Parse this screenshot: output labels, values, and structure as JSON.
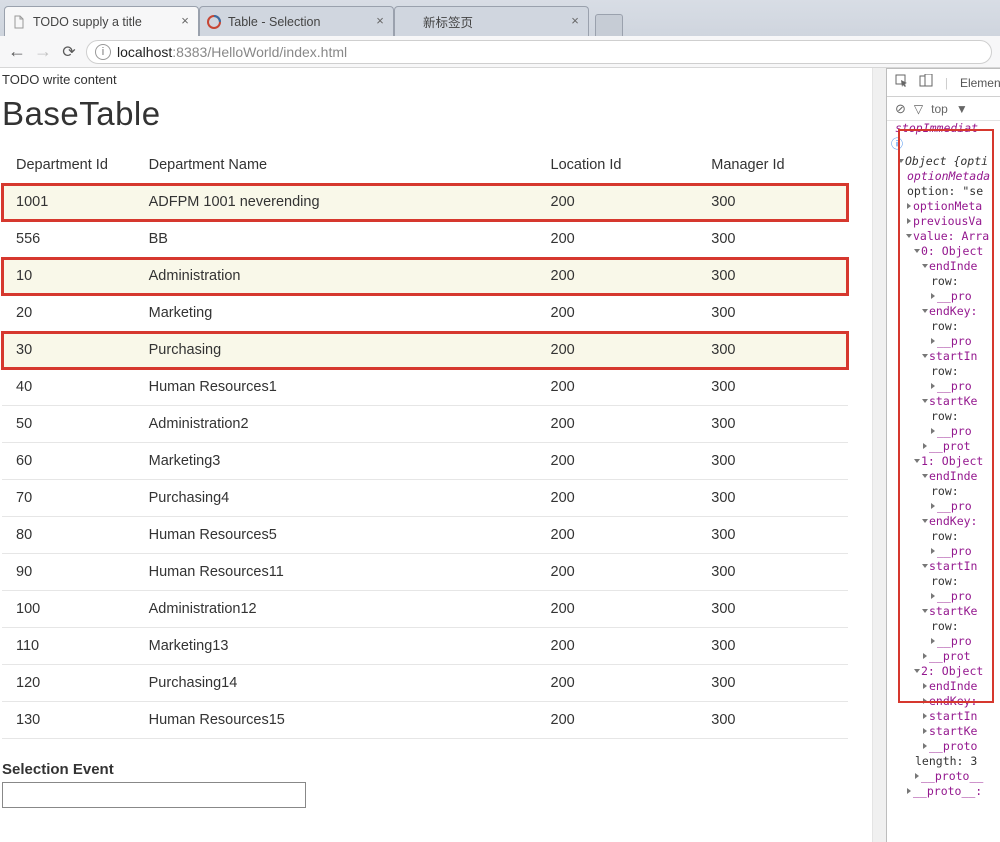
{
  "chrome": {
    "tabs": [
      {
        "title": "TODO supply a title",
        "favicon": "file"
      },
      {
        "title": "Table - Selection",
        "favicon": "oracle"
      },
      {
        "title": "新标签页",
        "favicon": ""
      }
    ],
    "url_host": "localhost",
    "url_port": ":8383",
    "url_path": "/HelloWorld/index.html"
  },
  "page": {
    "todo": "TODO write content",
    "heading": "BaseTable",
    "columns": [
      "Department Id",
      "Department Name",
      "Location Id",
      "Manager Id"
    ],
    "rows": [
      {
        "selected": true,
        "id": "1001",
        "name": "ADFPM 1001 neverending",
        "loc": "200",
        "mgr": "300"
      },
      {
        "selected": false,
        "id": "556",
        "name": "BB",
        "loc": "200",
        "mgr": "300"
      },
      {
        "selected": true,
        "id": "10",
        "name": "Administration",
        "loc": "200",
        "mgr": "300"
      },
      {
        "selected": false,
        "id": "20",
        "name": "Marketing",
        "loc": "200",
        "mgr": "300"
      },
      {
        "selected": true,
        "id": "30",
        "name": "Purchasing",
        "loc": "200",
        "mgr": "300"
      },
      {
        "selected": false,
        "id": "40",
        "name": "Human Resources1",
        "loc": "200",
        "mgr": "300"
      },
      {
        "selected": false,
        "id": "50",
        "name": "Administration2",
        "loc": "200",
        "mgr": "300"
      },
      {
        "selected": false,
        "id": "60",
        "name": "Marketing3",
        "loc": "200",
        "mgr": "300"
      },
      {
        "selected": false,
        "id": "70",
        "name": "Purchasing4",
        "loc": "200",
        "mgr": "300"
      },
      {
        "selected": false,
        "id": "80",
        "name": "Human Resources5",
        "loc": "200",
        "mgr": "300"
      },
      {
        "selected": false,
        "id": "90",
        "name": "Human Resources11",
        "loc": "200",
        "mgr": "300"
      },
      {
        "selected": false,
        "id": "100",
        "name": "Administration12",
        "loc": "200",
        "mgr": "300"
      },
      {
        "selected": false,
        "id": "110",
        "name": "Marketing13",
        "loc": "200",
        "mgr": "300"
      },
      {
        "selected": false,
        "id": "120",
        "name": "Purchasing14",
        "loc": "200",
        "mgr": "300"
      },
      {
        "selected": false,
        "id": "130",
        "name": "Human Resources15",
        "loc": "200",
        "mgr": "300"
      }
    ],
    "selection_label": "Selection Event"
  },
  "devtools": {
    "tab_label": "Elemen",
    "filter_label": "top",
    "stop_line": "stopImmediat",
    "lines": [
      {
        "pad": 1,
        "arrow": "open",
        "text": "Object {opti",
        "cls": "k-italic"
      },
      {
        "pad": 2,
        "arrow": "none",
        "text": "optionMetada",
        "cls": "k-purple k-italic"
      },
      {
        "pad": 2,
        "arrow": "none",
        "text": "option: \"se",
        "cls": ""
      },
      {
        "pad": 2,
        "arrow": "closed",
        "text": "optionMeta",
        "cls": "k-purple"
      },
      {
        "pad": 2,
        "arrow": "closed",
        "text": "previousVa",
        "cls": "k-purple"
      },
      {
        "pad": 2,
        "arrow": "open",
        "text": "value: Arra",
        "cls": "k-purple"
      },
      {
        "pad": 3,
        "arrow": "open",
        "text": "0: Object",
        "cls": "k-purple"
      },
      {
        "pad": 4,
        "arrow": "open",
        "text": "endInde",
        "cls": "k-purple"
      },
      {
        "pad": 5,
        "arrow": "none",
        "text": "row:",
        "cls": ""
      },
      {
        "pad": 5,
        "arrow": "closed",
        "text": "__pro",
        "cls": "k-purple"
      },
      {
        "pad": 4,
        "arrow": "open",
        "text": "endKey:",
        "cls": "k-purple"
      },
      {
        "pad": 5,
        "arrow": "none",
        "text": "row:",
        "cls": ""
      },
      {
        "pad": 5,
        "arrow": "closed",
        "text": "__pro",
        "cls": "k-purple"
      },
      {
        "pad": 4,
        "arrow": "open",
        "text": "startIn",
        "cls": "k-purple"
      },
      {
        "pad": 5,
        "arrow": "none",
        "text": "row:",
        "cls": ""
      },
      {
        "pad": 5,
        "arrow": "closed",
        "text": "__pro",
        "cls": "k-purple"
      },
      {
        "pad": 4,
        "arrow": "open",
        "text": "startKe",
        "cls": "k-purple"
      },
      {
        "pad": 5,
        "arrow": "none",
        "text": "row:",
        "cls": ""
      },
      {
        "pad": 5,
        "arrow": "closed",
        "text": "__pro",
        "cls": "k-purple"
      },
      {
        "pad": 4,
        "arrow": "closed",
        "text": "__prot",
        "cls": "k-purple"
      },
      {
        "pad": 3,
        "arrow": "open",
        "text": "1: Object",
        "cls": "k-purple"
      },
      {
        "pad": 4,
        "arrow": "open",
        "text": "endInde",
        "cls": "k-purple"
      },
      {
        "pad": 5,
        "arrow": "none",
        "text": "row:",
        "cls": ""
      },
      {
        "pad": 5,
        "arrow": "closed",
        "text": "__pro",
        "cls": "k-purple"
      },
      {
        "pad": 4,
        "arrow": "open",
        "text": "endKey:",
        "cls": "k-purple"
      },
      {
        "pad": 5,
        "arrow": "none",
        "text": "row:",
        "cls": ""
      },
      {
        "pad": 5,
        "arrow": "closed",
        "text": "__pro",
        "cls": "k-purple"
      },
      {
        "pad": 4,
        "arrow": "open",
        "text": "startIn",
        "cls": "k-purple"
      },
      {
        "pad": 5,
        "arrow": "none",
        "text": "row:",
        "cls": ""
      },
      {
        "pad": 5,
        "arrow": "closed",
        "text": "__pro",
        "cls": "k-purple"
      },
      {
        "pad": 4,
        "arrow": "open",
        "text": "startKe",
        "cls": "k-purple"
      },
      {
        "pad": 5,
        "arrow": "none",
        "text": "row:",
        "cls": ""
      },
      {
        "pad": 5,
        "arrow": "closed",
        "text": "__pro",
        "cls": "k-purple"
      },
      {
        "pad": 4,
        "arrow": "closed",
        "text": "__prot",
        "cls": "k-purple"
      },
      {
        "pad": 3,
        "arrow": "open",
        "text": "2: Object",
        "cls": "k-purple"
      },
      {
        "pad": 4,
        "arrow": "closed",
        "text": "endInde",
        "cls": "k-purple"
      },
      {
        "pad": 4,
        "arrow": "closed",
        "text": "endKey:",
        "cls": "k-purple"
      },
      {
        "pad": 4,
        "arrow": "closed",
        "text": "startIn",
        "cls": "k-purple"
      },
      {
        "pad": 4,
        "arrow": "closed",
        "text": "startKe",
        "cls": "k-purple"
      },
      {
        "pad": 4,
        "arrow": "closed",
        "text": "__proto",
        "cls": "k-purple"
      },
      {
        "pad": 3,
        "arrow": "none",
        "text": "length: 3",
        "cls": ""
      },
      {
        "pad": 3,
        "arrow": "closed",
        "text": "__proto__",
        "cls": "k-purple"
      },
      {
        "pad": 2,
        "arrow": "closed",
        "text": "__proto__:",
        "cls": "k-purple"
      }
    ]
  }
}
